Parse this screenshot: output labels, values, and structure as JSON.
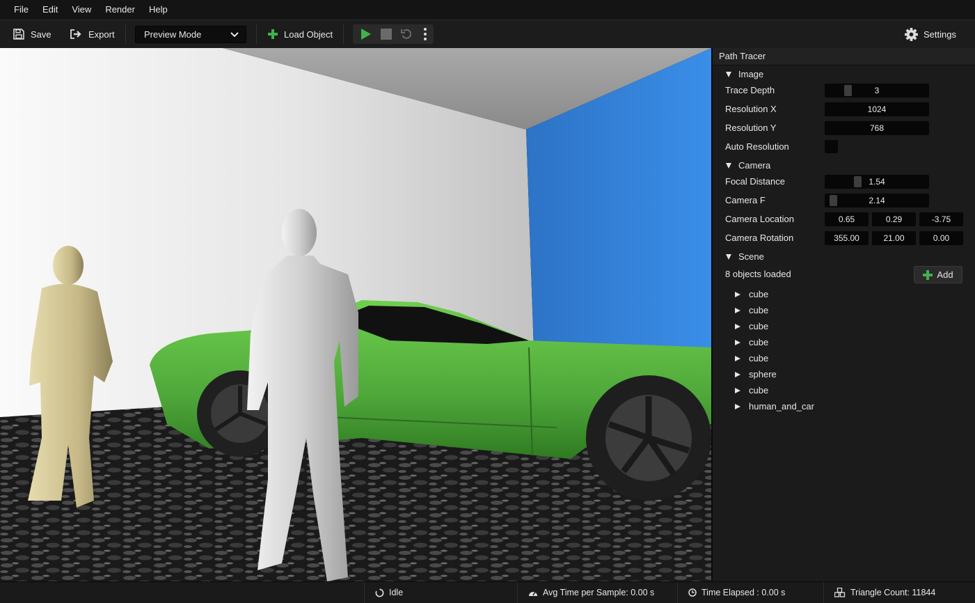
{
  "menu": [
    "File",
    "Edit",
    "View",
    "Render",
    "Help"
  ],
  "toolbar": {
    "save_label": "Save",
    "export_label": "Export",
    "mode_value": "Preview Mode",
    "load_label": "Load Object",
    "settings_label": "Settings"
  },
  "panel": {
    "title": "Path Tracer",
    "image": {
      "header": "Image",
      "trace_depth_label": "Trace Depth",
      "trace_depth": "3",
      "trace_depth_fraction": 0.2,
      "res_x_label": "Resolution X",
      "res_x": "1024",
      "res_y_label": "Resolution Y",
      "res_y": "768",
      "auto_res_label": "Auto Resolution",
      "auto_res_checked": false
    },
    "camera": {
      "header": "Camera",
      "focal_label": "Focal Distance",
      "focal": "1.54",
      "focal_fraction": 0.3,
      "f_label": "Camera F",
      "f": "2.14",
      "f_fraction": 0.05,
      "location_label": "Camera Location",
      "location": [
        "0.65",
        "0.29",
        "-3.75"
      ],
      "rotation_label": "Camera Rotation",
      "rotation": [
        "355.00",
        "21.00",
        "0.00"
      ]
    },
    "scene": {
      "header": "Scene",
      "count_text": "8 objects loaded",
      "add_label": "Add",
      "objects": [
        "cube",
        "cube",
        "cube",
        "cube",
        "cube",
        "sphere",
        "cube",
        "human_and_car"
      ]
    }
  },
  "status": {
    "state": "Idle",
    "avg_time": "Avg Time per Sample: 0.00 s",
    "elapsed": "Time Elapsed :  0.00 s",
    "triangles": "Triangle Count: 11844"
  },
  "colors": {
    "accent_green": "#3fb34a",
    "wall_blue": "#2f7fd6",
    "car_green": "#4fa83a"
  }
}
